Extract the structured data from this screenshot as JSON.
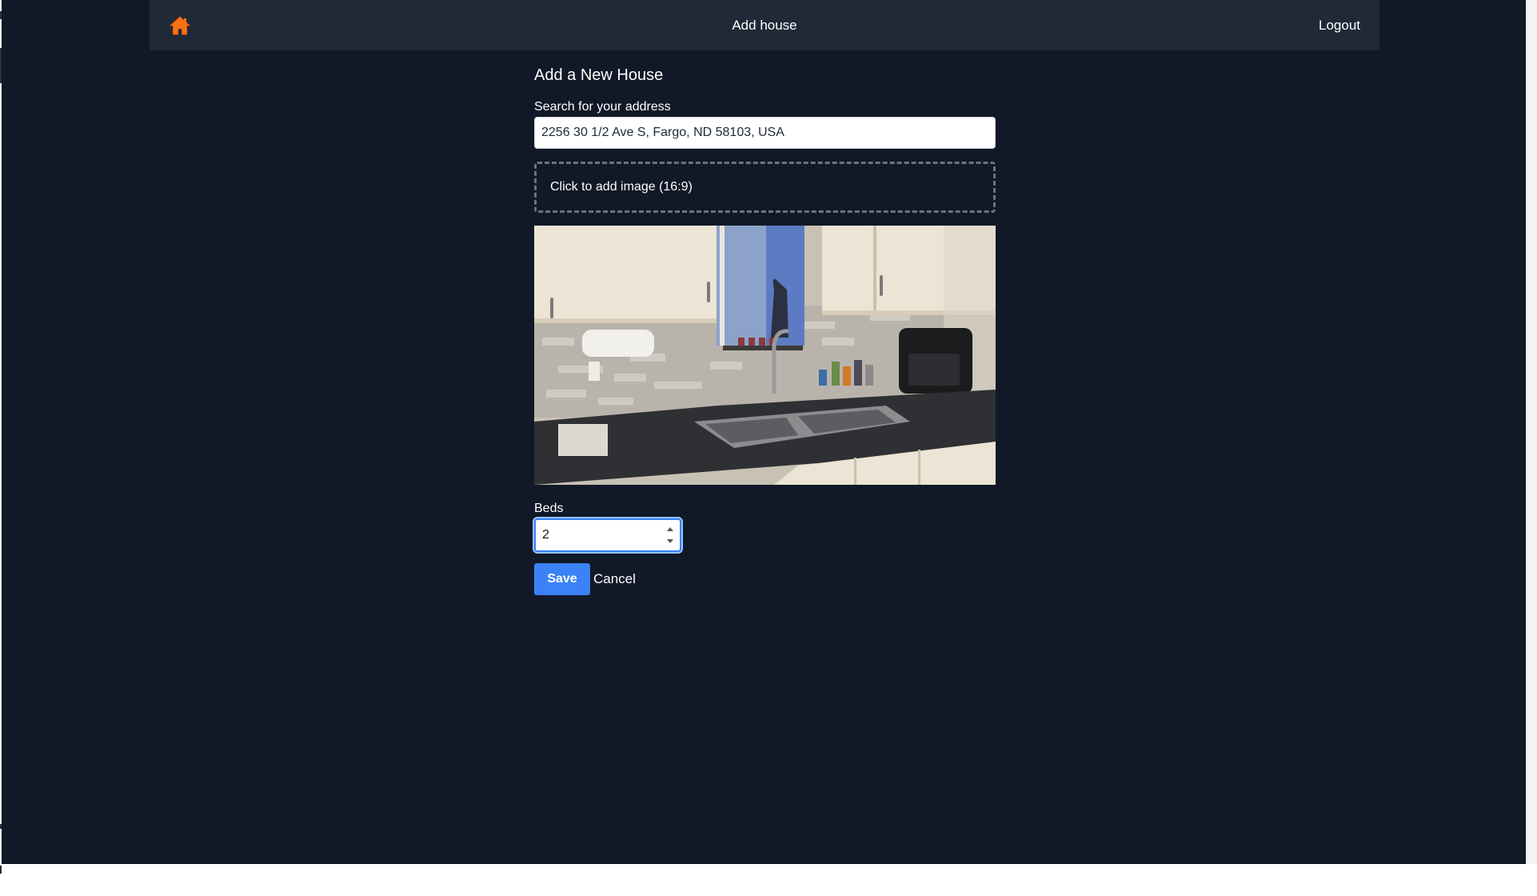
{
  "navbar": {
    "home_icon": "home-icon",
    "title": "Add house",
    "logout_label": "Logout"
  },
  "form": {
    "heading": "Add a New House",
    "address": {
      "label": "Search for your address",
      "value": "2256 30 1/2 Ave S, Fargo, ND 58103, USA"
    },
    "image": {
      "dropzone_label": "Click to add image (16:9)",
      "preview": "kitchen-photo"
    },
    "beds": {
      "label": "Beds",
      "value": "2"
    },
    "save_label": "Save",
    "cancel_label": "Cancel"
  },
  "colors": {
    "page_background": "#111827",
    "navbar_background": "#1f2937",
    "accent": "#3b82f6",
    "home_icon": "#f97316"
  }
}
